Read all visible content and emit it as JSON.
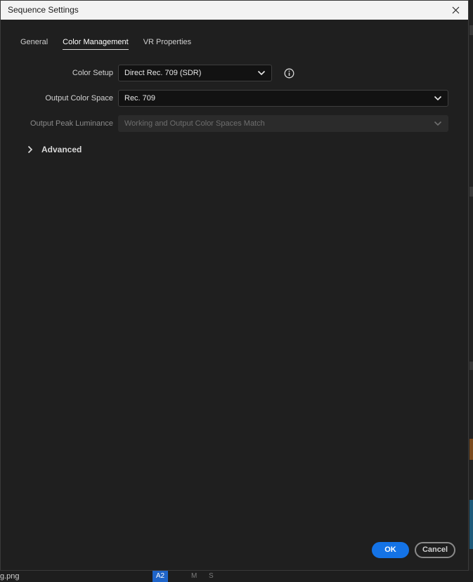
{
  "window": {
    "title": "Sequence Settings"
  },
  "tabs": [
    {
      "label": "General",
      "active": false
    },
    {
      "label": "Color Management",
      "active": true
    },
    {
      "label": "VR Properties",
      "active": false
    }
  ],
  "fields": {
    "color_setup": {
      "label": "Color Setup",
      "value": "Direct Rec. 709 (SDR)"
    },
    "output_color_space": {
      "label": "Output Color Space",
      "value": "Rec. 709"
    },
    "output_peak_luminance": {
      "label": "Output Peak Luminance",
      "value": "Working and Output Color Spaces Match",
      "disabled": true
    }
  },
  "advanced": {
    "label": "Advanced",
    "expanded": false
  },
  "buttons": {
    "ok": "OK",
    "cancel": "Cancel"
  },
  "background": {
    "file_name": "g.png",
    "track_label": "A2",
    "track_m": "M",
    "track_s": "S"
  },
  "colors": {
    "accent": "#1473e6",
    "dialog_bg": "#1f1f1f",
    "titlebar_bg": "#f3f3f3"
  },
  "icons": {
    "close": "close-icon",
    "info": "info-icon",
    "chevron": "chevron-down-icon",
    "expand": "chevron-right-icon"
  }
}
